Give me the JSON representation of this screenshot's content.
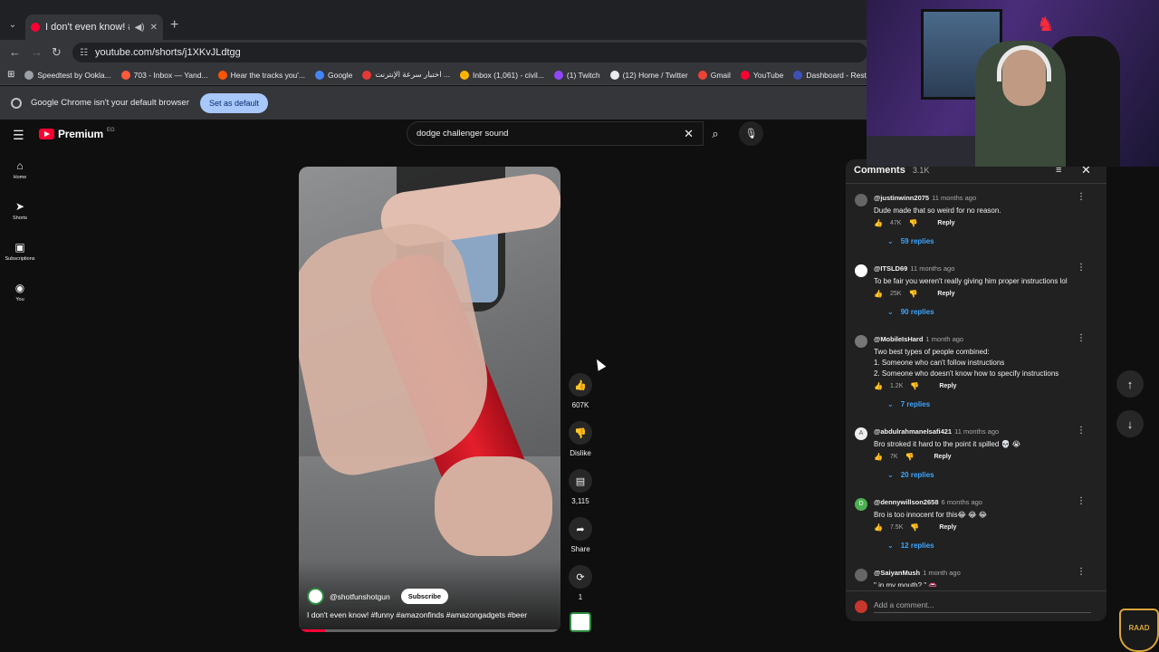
{
  "browser": {
    "tab_title": "I don't even know! #funny #",
    "url": "youtube.com/shorts/j1XKvJLdtgg",
    "bookmarks": [
      {
        "label": "Speedtest by Ookla...",
        "color": "#9aa0a6"
      },
      {
        "label": "703 - Inbox — Yand...",
        "color": "#ff5a3c"
      },
      {
        "label": "Hear the tracks you'...",
        "color": "#ff5500"
      },
      {
        "label": "Google",
        "color": "#4285f4"
      },
      {
        "label": "اختبار سرعة الإنترنت ...",
        "color": "#e53935"
      },
      {
        "label": "Inbox (1,061) - civil...",
        "color": "#ffb300"
      },
      {
        "label": "(1) Twitch",
        "color": "#9146ff"
      },
      {
        "label": "(12) Home / Twitter",
        "color": "#e8eaed"
      },
      {
        "label": "Gmail",
        "color": "#ea4335"
      },
      {
        "label": "YouTube",
        "color": "#ff0033"
      },
      {
        "label": "Dashboard - Restre...",
        "color": "#3f51b5"
      }
    ],
    "infobar_text": "Google Chrome isn't your default browser",
    "infobar_button": "Set as default"
  },
  "youtube": {
    "logo_text": "Premium",
    "country": "EG",
    "search_value": "dodge challenger sound",
    "nav": [
      {
        "label": "Home",
        "icon": "home-icon",
        "glyph": "⌂"
      },
      {
        "label": "Shorts",
        "icon": "shorts-icon",
        "glyph": "➤"
      },
      {
        "label": "Subscriptions",
        "icon": "subscriptions-icon",
        "glyph": "▣"
      },
      {
        "label": "You",
        "icon": "you-icon",
        "glyph": "◉"
      }
    ]
  },
  "short": {
    "channel": "@shotfunshotgun",
    "subscribe_label": "Subscribe",
    "title": "I don't even know! #funny #amazonfinds #amazongadgets #beer",
    "progress": 0.1,
    "likes": "607K",
    "dislike_label": "Dislike",
    "comments_count": "3,115",
    "share_label": "Share",
    "remix_count": "1"
  },
  "comments": {
    "header": "Comments",
    "count": "3.1K",
    "add_placeholder": "Add a comment...",
    "items": [
      {
        "user": "@justinwinn2075",
        "time": "11 months ago",
        "text": "Dude made that so weird for no reason.",
        "likes": "47K",
        "replies": "59 replies",
        "avatar_color": "#666",
        "avatar_letter": ""
      },
      {
        "user": "@ITSLD69",
        "time": "11 months ago",
        "text": "To be fair you weren't really giving him proper instructions lol",
        "likes": "25K",
        "replies": "90 replies",
        "avatar_color": "#ffffff",
        "avatar_letter": ""
      },
      {
        "user": "@MobileIsHard",
        "time": "1 month ago",
        "text": "Two best types of people combined:\n1. Someone who can't follow instructions\n2. Someone who doesn't know how to specify instructions",
        "likes": "1.2K",
        "replies": "7 replies",
        "avatar_color": "#777",
        "avatar_letter": ""
      },
      {
        "user": "@abdulrahmanelsafi421",
        "time": "11 months ago",
        "text": "Bro stroked it hard to the point it spilled 💀 😭",
        "likes": "7K",
        "replies": "20 replies",
        "avatar_color": "#eeeeee",
        "avatar_letter": "A"
      },
      {
        "user": "@dennywillson2658",
        "time": "6 months ago",
        "text": "Bro is too innocent for this😂 😂 😂",
        "likes": "7.5K",
        "replies": "12 replies",
        "avatar_color": "#4caf50",
        "avatar_letter": "D"
      },
      {
        "user": "@SaiyanMush",
        "time": "1 month ago",
        "text": "\" in my mouth? \" 👄",
        "likes": "",
        "replies": "",
        "avatar_color": "#666",
        "avatar_letter": ""
      }
    ]
  },
  "overlay": {
    "brand": "RAAD"
  }
}
